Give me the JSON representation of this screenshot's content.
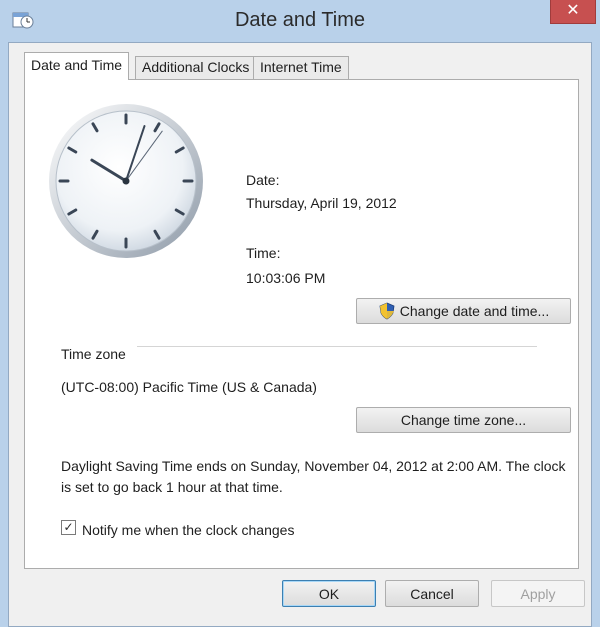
{
  "window": {
    "title": "Date and Time",
    "close_glyph": "✕"
  },
  "tabs": [
    {
      "label": "Date and Time",
      "active": true
    },
    {
      "label": "Additional Clocks",
      "active": false
    },
    {
      "label": "Internet Time",
      "active": false
    }
  ],
  "date": {
    "label": "Date:",
    "value": "Thursday, April 19, 2012"
  },
  "time": {
    "label": "Time:",
    "value": "10:03:06 PM"
  },
  "clock": {
    "hour": 10,
    "minute": 3,
    "second": 6
  },
  "change_datetime_button": "Change date and time...",
  "timezone": {
    "section_label": "Time zone",
    "value": "(UTC-08:00) Pacific Time (US & Canada)",
    "change_button": "Change time zone..."
  },
  "dst_notice": "Daylight Saving Time ends on Sunday, November 04, 2012 at 2:00 AM. The clock is set to go back 1 hour at that time.",
  "notify": {
    "label": "Notify me when the clock changes",
    "checked": true,
    "check_glyph": "✓"
  },
  "footer": {
    "ok": "OK",
    "cancel": "Cancel",
    "apply": "Apply"
  },
  "icons": {
    "app": "date-time-app-icon",
    "shield": "uac-shield-icon"
  }
}
